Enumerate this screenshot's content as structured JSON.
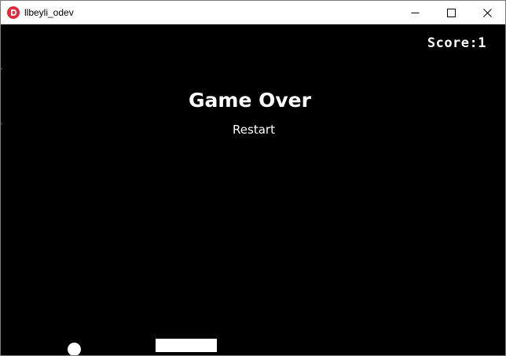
{
  "window": {
    "title": "llbeyli_odev",
    "icon": "app-logo-d-icon",
    "controls": {
      "minimize": "minimize-icon",
      "maximize": "maximize-icon",
      "close": "close-icon"
    }
  },
  "game": {
    "score_text": "Score:1",
    "game_over_text": "Game Over",
    "restart_label": "Restart"
  },
  "colors": {
    "background": "#000000",
    "foreground": "#ffffff",
    "icon_accent": "#e02b3c"
  }
}
